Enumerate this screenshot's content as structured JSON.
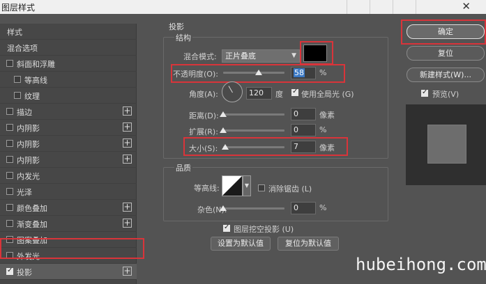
{
  "window": {
    "title": "图层样式",
    "close_glyph": "✕"
  },
  "left_list": {
    "header": "样式",
    "items": [
      {
        "label": "混合选项",
        "checkbox": false,
        "checked": false,
        "plus": false
      },
      {
        "label": "斜面和浮雕",
        "checkbox": true,
        "checked": false,
        "plus": false
      },
      {
        "label": "等高线",
        "checkbox": true,
        "checked": false,
        "plus": false,
        "indent": true
      },
      {
        "label": "纹理",
        "checkbox": true,
        "checked": false,
        "plus": false,
        "indent": true
      },
      {
        "label": "描边",
        "checkbox": true,
        "checked": false,
        "plus": true
      },
      {
        "label": "内阴影",
        "checkbox": true,
        "checked": false,
        "plus": true
      },
      {
        "label": "内阴影",
        "checkbox": true,
        "checked": false,
        "plus": true
      },
      {
        "label": "内阴影",
        "checkbox": true,
        "checked": false,
        "plus": true
      },
      {
        "label": "内发光",
        "checkbox": true,
        "checked": false,
        "plus": false
      },
      {
        "label": "光泽",
        "checkbox": true,
        "checked": false,
        "plus": false
      },
      {
        "label": "颜色叠加",
        "checkbox": true,
        "checked": false,
        "plus": true
      },
      {
        "label": "渐变叠加",
        "checkbox": true,
        "checked": false,
        "plus": true
      },
      {
        "label": "图案叠加",
        "checkbox": true,
        "checked": false,
        "plus": false
      },
      {
        "label": "外发光",
        "checkbox": true,
        "checked": false,
        "plus": false
      },
      {
        "label": "投影",
        "checkbox": true,
        "checked": true,
        "plus": true,
        "selected": true
      }
    ],
    "plus_glyph": "+"
  },
  "shadow": {
    "section_title": "投影",
    "structure_title": "结构",
    "blend_mode": {
      "label": "混合模式:",
      "value": "正片叠底"
    },
    "shadow_color": "#000000",
    "opacity": {
      "label": "不透明度(O):",
      "value": "58",
      "unit": "%",
      "level": 0.58
    },
    "angle": {
      "label": "角度(A):",
      "value": "120",
      "unit": "度"
    },
    "use_global_light": {
      "label": "使用全局光 (G)",
      "checked": true
    },
    "distance": {
      "label": "距离(D):",
      "value": "0",
      "unit": "像素",
      "level": 0
    },
    "spread": {
      "label": "扩展(R):",
      "value": "0",
      "unit": "%",
      "level": 0
    },
    "size": {
      "label": "大小(S):",
      "value": "7",
      "unit": "像素",
      "level": 0.03
    },
    "quality_title": "品质",
    "contour": {
      "label": "等高线:"
    },
    "anti_alias": {
      "label": "消除锯齿 (L)",
      "checked": false
    },
    "noise": {
      "label": "杂色(N):",
      "value": "0",
      "unit": "%",
      "level": 0
    },
    "knockout": {
      "label": "图层挖空投影 (U)",
      "checked": true
    },
    "set_default_button": "设置为默认值",
    "reset_default_button": "复位为默认值"
  },
  "actions": {
    "ok": "确定",
    "reset": "复位",
    "new_style": "新建样式(W)...",
    "preview": {
      "label": "预览(V)",
      "checked": true
    }
  },
  "watermark": "hubeihong.com",
  "accent_red": "#d9343a",
  "highlight_blue": "#3b79c5"
}
